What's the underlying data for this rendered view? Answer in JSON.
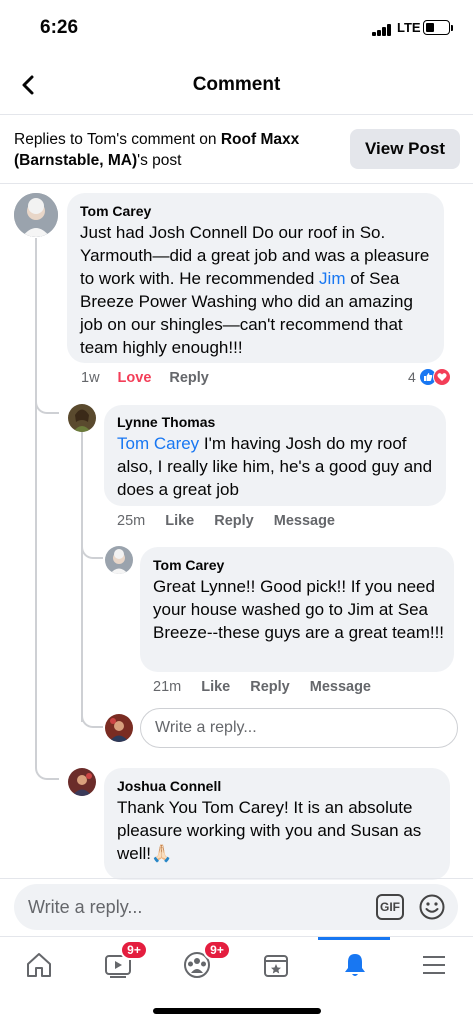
{
  "status": {
    "time": "6:26",
    "network": "LTE"
  },
  "header": {
    "title": "Comment"
  },
  "replies_bar": {
    "prefix": "Replies to Tom's comment on ",
    "page_name": "Roof Maxx (Barnstable, MA)",
    "suffix": "'s post",
    "view_post": "View Post"
  },
  "comments": [
    {
      "author": "Tom Carey",
      "text_before": "Just had Josh Connell Do our roof in So. Yarmouth—did a great job and was a pleasure to work with. He recommended ",
      "mention": "Jim",
      "text_after": " of Sea Breeze Power Washing who did an amazing job on our shingles—can't recommend that team highly enough!!!",
      "time": "1w",
      "reaction_action": "Love",
      "reply": "Reply",
      "reaction_count": "4"
    },
    {
      "author": "Lynne Thomas",
      "mention": "Tom Carey",
      "text": " I'm having Josh do my roof also, I really like him, he's a good guy and does a great job",
      "time": "25m",
      "like": "Like",
      "reply": "Reply",
      "message": "Message"
    },
    {
      "author": "Tom Carey",
      "text": "Great Lynne!! Good pick!! If you need your house washed go to Jim at Sea Breeze--these guys are a great team!!!",
      "time": "21m",
      "like": "Like",
      "reply": "Reply",
      "message": "Message"
    },
    {
      "author": "Joshua Connell",
      "text": "Thank You Tom Carey! It is an absolute pleasure working with you and Susan as well!🙏🏻"
    }
  ],
  "inline_reply_placeholder": "Write a reply...",
  "composer": {
    "placeholder": "Write a reply...",
    "gif": "GIF"
  },
  "tabbar": {
    "video_badge": "9+",
    "groups_badge": "9+"
  },
  "colors": {
    "link": "#1877f2",
    "love": "#f33e58",
    "bubble": "#f0f2f5",
    "active_tab": "#1877f2"
  }
}
